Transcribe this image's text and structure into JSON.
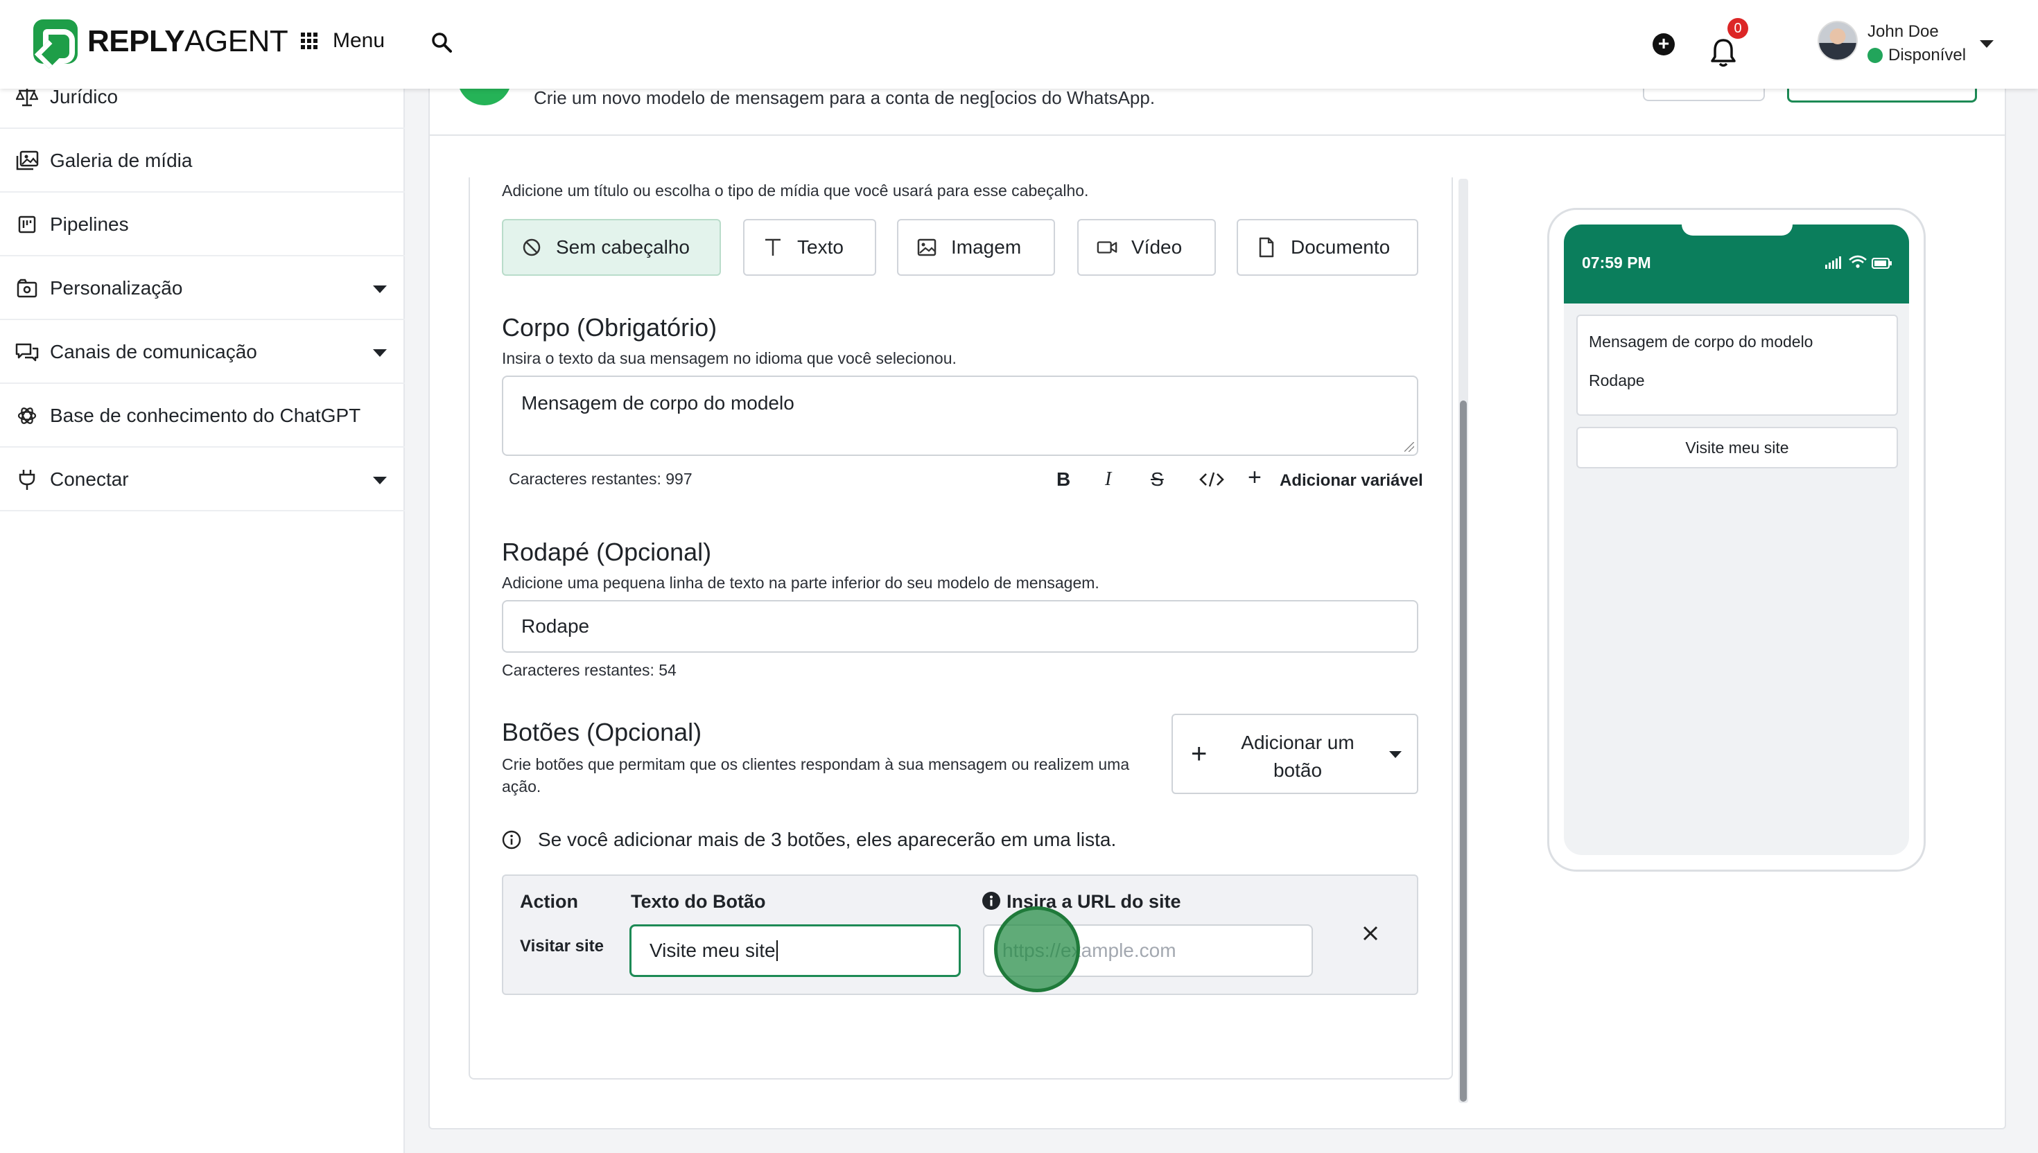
{
  "topbar": {
    "brand_bold": "REPLY",
    "brand_rest": "AGENT",
    "menu_label": "Menu",
    "notifications_count": "0",
    "user_name": "John Doe",
    "user_status": "Disponível"
  },
  "sidebar": {
    "items": [
      {
        "label": "Jurídico",
        "icon": "scale-icon"
      },
      {
        "label": "Galeria de mídia",
        "icon": "media-gallery-icon"
      },
      {
        "label": "Pipelines",
        "icon": "pipeline-icon"
      },
      {
        "label": "Personalização",
        "icon": "customize-icon"
      },
      {
        "label": "Canais de comunicação",
        "icon": "chat-channels-icon"
      },
      {
        "label": "Base de conhecimento do ChatGPT",
        "icon": "chatgpt-icon"
      },
      {
        "label": "Conectar",
        "icon": "plug-icon"
      }
    ]
  },
  "header": {
    "description": "Crie um novo modelo de mensagem para a conta de neg[ocios do WhatsApp."
  },
  "form": {
    "header_hint": "Adicione um título ou escolha o tipo de mídia que você usará para esse cabeçalho.",
    "header_options": [
      "Sem cabeçalho",
      "Texto",
      "Imagem",
      "Vídeo",
      "Documento"
    ],
    "body_title": "Corpo (Obrigatório)",
    "body_hint": "Insira o texto da sua mensagem no idioma que você selecionou.",
    "body_value": "Mensagem de corpo do modelo",
    "body_remaining": "Caracteres restantes: 997",
    "add_variable": "Adicionar variável",
    "footer_title": "Rodapé (Opcional)",
    "footer_hint": "Adicione uma pequena linha de texto na parte inferior do seu modelo de mensagem.",
    "footer_value": "Rodape",
    "footer_remaining": "Caracteres restantes: 54",
    "buttons_title": "Botões (Opcional)",
    "buttons_hint_line1": "Crie botões que permitam que os clientes respondam à sua mensagem ou realizem uma",
    "buttons_hint_line2": "ação.",
    "add_button_label": "Adicionar um botão",
    "buttons_info": "Se você adicionar mais de 3 botões, eles aparecerão em uma lista.",
    "col_action": "Action",
    "col_button_text": "Texto do Botão",
    "col_url": "Insira a URL do site",
    "action_value": "Visitar site",
    "button_text_value": "Visite meu site",
    "url_placeholder": "https://example.com"
  },
  "preview": {
    "time": "07:59 PM",
    "body": "Mensagem de corpo do modelo",
    "footer": "Rodape",
    "link_button": "Visite meu site"
  },
  "colors": {
    "brand_green": "#1e9e48",
    "whatsapp_bar": "#0b7e5c",
    "status_green": "#22a55b",
    "badge_red": "#dc2626"
  }
}
